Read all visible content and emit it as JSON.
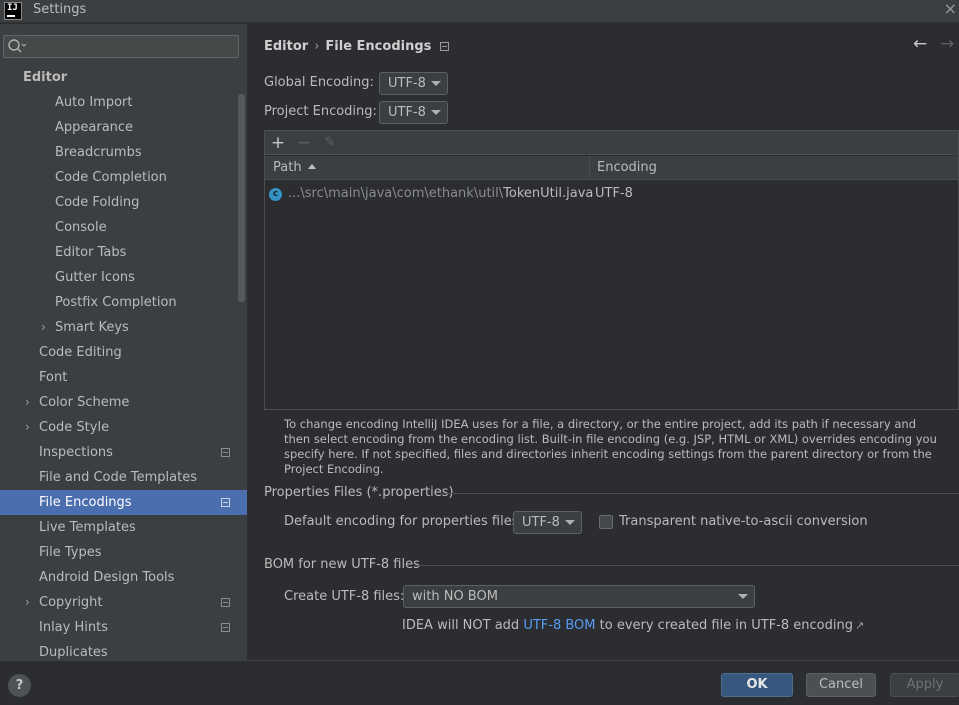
{
  "window": {
    "title": "Settings",
    "logo_text": "IJ",
    "close_glyph": "×"
  },
  "sidebar": {
    "search": {
      "value": "",
      "placeholder": ""
    },
    "section": "Editor",
    "items": [
      {
        "label": "Auto Import",
        "indent": 2,
        "expandable": false,
        "badge": false
      },
      {
        "label": "Appearance",
        "indent": 2,
        "expandable": false,
        "badge": false
      },
      {
        "label": "Breadcrumbs",
        "indent": 2,
        "expandable": false,
        "badge": false
      },
      {
        "label": "Code Completion",
        "indent": 2,
        "expandable": false,
        "badge": false
      },
      {
        "label": "Code Folding",
        "indent": 2,
        "expandable": false,
        "badge": false
      },
      {
        "label": "Console",
        "indent": 2,
        "expandable": false,
        "badge": false
      },
      {
        "label": "Editor Tabs",
        "indent": 2,
        "expandable": false,
        "badge": false
      },
      {
        "label": "Gutter Icons",
        "indent": 2,
        "expandable": false,
        "badge": false
      },
      {
        "label": "Postfix Completion",
        "indent": 2,
        "expandable": false,
        "badge": false
      },
      {
        "label": "Smart Keys",
        "indent": 2,
        "expandable": true,
        "badge": false
      },
      {
        "label": "Code Editing",
        "indent": 1,
        "expandable": false,
        "badge": false
      },
      {
        "label": "Font",
        "indent": 1,
        "expandable": false,
        "badge": false
      },
      {
        "label": "Color Scheme",
        "indent": 1,
        "expandable": true,
        "badge": false
      },
      {
        "label": "Code Style",
        "indent": 1,
        "expandable": true,
        "badge": false
      },
      {
        "label": "Inspections",
        "indent": 1,
        "expandable": false,
        "badge": true
      },
      {
        "label": "File and Code Templates",
        "indent": 1,
        "expandable": false,
        "badge": false
      },
      {
        "label": "File Encodings",
        "indent": 1,
        "expandable": false,
        "badge": true,
        "selected": true
      },
      {
        "label": "Live Templates",
        "indent": 1,
        "expandable": false,
        "badge": false
      },
      {
        "label": "File Types",
        "indent": 1,
        "expandable": false,
        "badge": false
      },
      {
        "label": "Android Design Tools",
        "indent": 1,
        "expandable": false,
        "badge": false
      },
      {
        "label": "Copyright",
        "indent": 1,
        "expandable": true,
        "badge": true
      },
      {
        "label": "Inlay Hints",
        "indent": 1,
        "expandable": false,
        "badge": true
      },
      {
        "label": "Duplicates",
        "indent": 1,
        "expandable": false,
        "badge": false
      }
    ]
  },
  "breadcrumb": {
    "parent": "Editor",
    "separator": "›",
    "current": "File Encodings"
  },
  "nav": {
    "back_glyph": "←",
    "forward_glyph": "→"
  },
  "encoding": {
    "global_label": "Global Encoding:",
    "global_value": "UTF-8",
    "project_label": "Project Encoding:",
    "project_value": "UTF-8"
  },
  "table": {
    "toolbar": {
      "add": "+",
      "remove": "−",
      "edit": "✎"
    },
    "columns": [
      "Path",
      "Encoding"
    ],
    "rows": [
      {
        "icon_letter": "c",
        "path_prefix": "...\\src\\main\\java\\com\\ethank\\util\\",
        "file_name": "TokenUtil.java",
        "encoding": "UTF-8"
      }
    ]
  },
  "help_text": "To change encoding IntelliJ IDEA uses for a file, a directory, or the entire project, add its path if necessary and then select encoding from the encoding list. Built-in file encoding (e.g. JSP, HTML or XML) overrides encoding you specify here. If not specified, files and directories inherit encoding settings from the parent directory or from the Project Encoding.",
  "properties": {
    "group_title": "Properties Files (*.properties)",
    "default_label": "Default encoding for properties files:",
    "default_value": "UTF-8",
    "native_ascii_label": "Transparent native-to-ascii conversion",
    "native_ascii_checked": false
  },
  "bom": {
    "group_title": "BOM for new UTF-8 files",
    "create_label": "Create UTF-8 files:",
    "create_value": "with NO BOM",
    "note_prefix": "IDEA will NOT add",
    "note_link": "UTF-8 BOM",
    "note_suffix": "to every created file in UTF-8 encoding",
    "note_arrow": "↗"
  },
  "footer": {
    "help": "?",
    "ok": "OK",
    "cancel": "Cancel",
    "apply": "Apply"
  },
  "colors": {
    "selection": "#4b6eaf",
    "link": "#589df6",
    "primary_button": "#365880"
  }
}
